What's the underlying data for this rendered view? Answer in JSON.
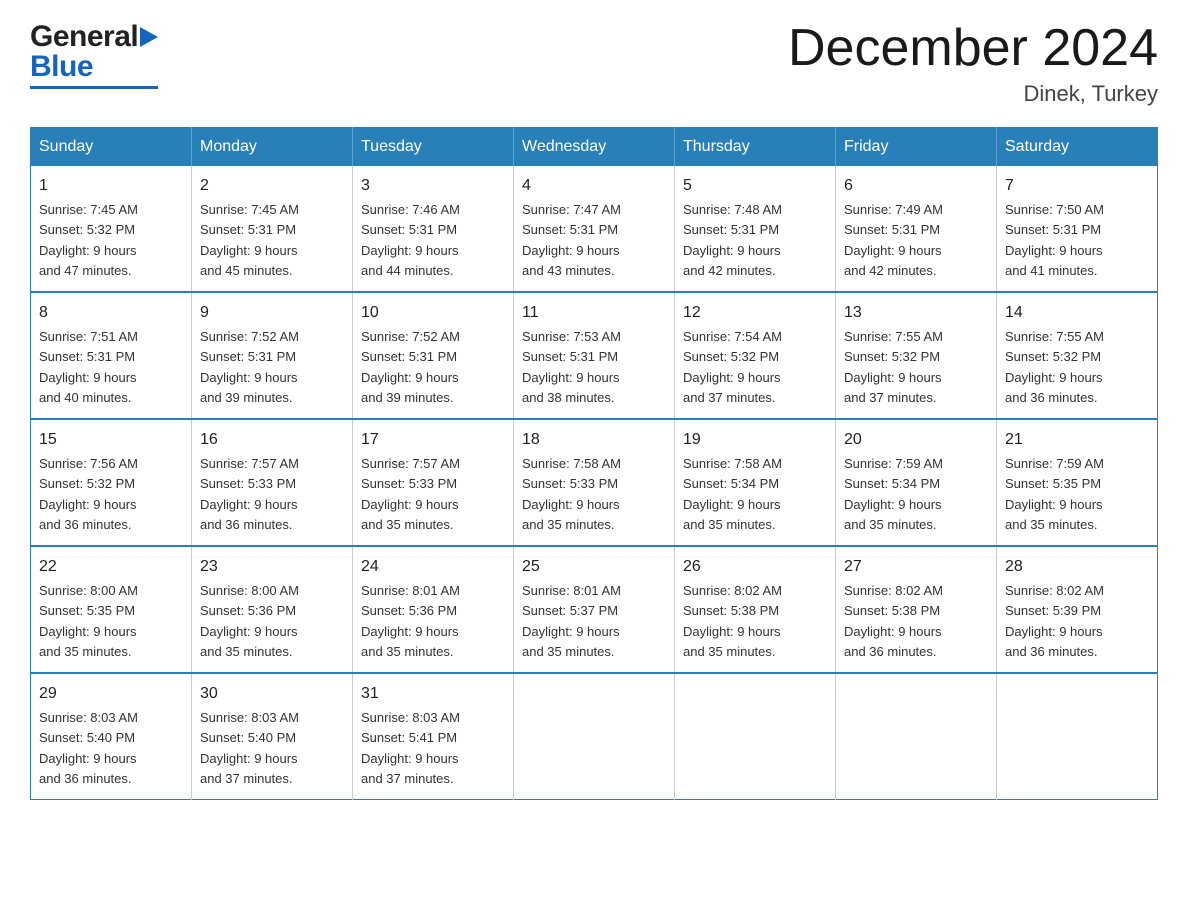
{
  "header": {
    "logo": {
      "general": "General",
      "blue": "Blue",
      "arrow": "▶"
    },
    "title": "December 2024",
    "location": "Dinek, Turkey"
  },
  "weekdays": [
    "Sunday",
    "Monday",
    "Tuesday",
    "Wednesday",
    "Thursday",
    "Friday",
    "Saturday"
  ],
  "weeks": [
    [
      {
        "day": "1",
        "sunrise": "7:45 AM",
        "sunset": "5:32 PM",
        "daylight": "9 hours and 47 minutes."
      },
      {
        "day": "2",
        "sunrise": "7:45 AM",
        "sunset": "5:31 PM",
        "daylight": "9 hours and 45 minutes."
      },
      {
        "day": "3",
        "sunrise": "7:46 AM",
        "sunset": "5:31 PM",
        "daylight": "9 hours and 44 minutes."
      },
      {
        "day": "4",
        "sunrise": "7:47 AM",
        "sunset": "5:31 PM",
        "daylight": "9 hours and 43 minutes."
      },
      {
        "day": "5",
        "sunrise": "7:48 AM",
        "sunset": "5:31 PM",
        "daylight": "9 hours and 42 minutes."
      },
      {
        "day": "6",
        "sunrise": "7:49 AM",
        "sunset": "5:31 PM",
        "daylight": "9 hours and 42 minutes."
      },
      {
        "day": "7",
        "sunrise": "7:50 AM",
        "sunset": "5:31 PM",
        "daylight": "9 hours and 41 minutes."
      }
    ],
    [
      {
        "day": "8",
        "sunrise": "7:51 AM",
        "sunset": "5:31 PM",
        "daylight": "9 hours and 40 minutes."
      },
      {
        "day": "9",
        "sunrise": "7:52 AM",
        "sunset": "5:31 PM",
        "daylight": "9 hours and 39 minutes."
      },
      {
        "day": "10",
        "sunrise": "7:52 AM",
        "sunset": "5:31 PM",
        "daylight": "9 hours and 39 minutes."
      },
      {
        "day": "11",
        "sunrise": "7:53 AM",
        "sunset": "5:31 PM",
        "daylight": "9 hours and 38 minutes."
      },
      {
        "day": "12",
        "sunrise": "7:54 AM",
        "sunset": "5:32 PM",
        "daylight": "9 hours and 37 minutes."
      },
      {
        "day": "13",
        "sunrise": "7:55 AM",
        "sunset": "5:32 PM",
        "daylight": "9 hours and 37 minutes."
      },
      {
        "day": "14",
        "sunrise": "7:55 AM",
        "sunset": "5:32 PM",
        "daylight": "9 hours and 36 minutes."
      }
    ],
    [
      {
        "day": "15",
        "sunrise": "7:56 AM",
        "sunset": "5:32 PM",
        "daylight": "9 hours and 36 minutes."
      },
      {
        "day": "16",
        "sunrise": "7:57 AM",
        "sunset": "5:33 PM",
        "daylight": "9 hours and 36 minutes."
      },
      {
        "day": "17",
        "sunrise": "7:57 AM",
        "sunset": "5:33 PM",
        "daylight": "9 hours and 35 minutes."
      },
      {
        "day": "18",
        "sunrise": "7:58 AM",
        "sunset": "5:33 PM",
        "daylight": "9 hours and 35 minutes."
      },
      {
        "day": "19",
        "sunrise": "7:58 AM",
        "sunset": "5:34 PM",
        "daylight": "9 hours and 35 minutes."
      },
      {
        "day": "20",
        "sunrise": "7:59 AM",
        "sunset": "5:34 PM",
        "daylight": "9 hours and 35 minutes."
      },
      {
        "day": "21",
        "sunrise": "7:59 AM",
        "sunset": "5:35 PM",
        "daylight": "9 hours and 35 minutes."
      }
    ],
    [
      {
        "day": "22",
        "sunrise": "8:00 AM",
        "sunset": "5:35 PM",
        "daylight": "9 hours and 35 minutes."
      },
      {
        "day": "23",
        "sunrise": "8:00 AM",
        "sunset": "5:36 PM",
        "daylight": "9 hours and 35 minutes."
      },
      {
        "day": "24",
        "sunrise": "8:01 AM",
        "sunset": "5:36 PM",
        "daylight": "9 hours and 35 minutes."
      },
      {
        "day": "25",
        "sunrise": "8:01 AM",
        "sunset": "5:37 PM",
        "daylight": "9 hours and 35 minutes."
      },
      {
        "day": "26",
        "sunrise": "8:02 AM",
        "sunset": "5:38 PM",
        "daylight": "9 hours and 35 minutes."
      },
      {
        "day": "27",
        "sunrise": "8:02 AM",
        "sunset": "5:38 PM",
        "daylight": "9 hours and 36 minutes."
      },
      {
        "day": "28",
        "sunrise": "8:02 AM",
        "sunset": "5:39 PM",
        "daylight": "9 hours and 36 minutes."
      }
    ],
    [
      {
        "day": "29",
        "sunrise": "8:03 AM",
        "sunset": "5:40 PM",
        "daylight": "9 hours and 36 minutes."
      },
      {
        "day": "30",
        "sunrise": "8:03 AM",
        "sunset": "5:40 PM",
        "daylight": "9 hours and 37 minutes."
      },
      {
        "day": "31",
        "sunrise": "8:03 AM",
        "sunset": "5:41 PM",
        "daylight": "9 hours and 37 minutes."
      },
      null,
      null,
      null,
      null
    ]
  ],
  "labels": {
    "sunrise": "Sunrise:",
    "sunset": "Sunset:",
    "daylight": "Daylight:"
  }
}
